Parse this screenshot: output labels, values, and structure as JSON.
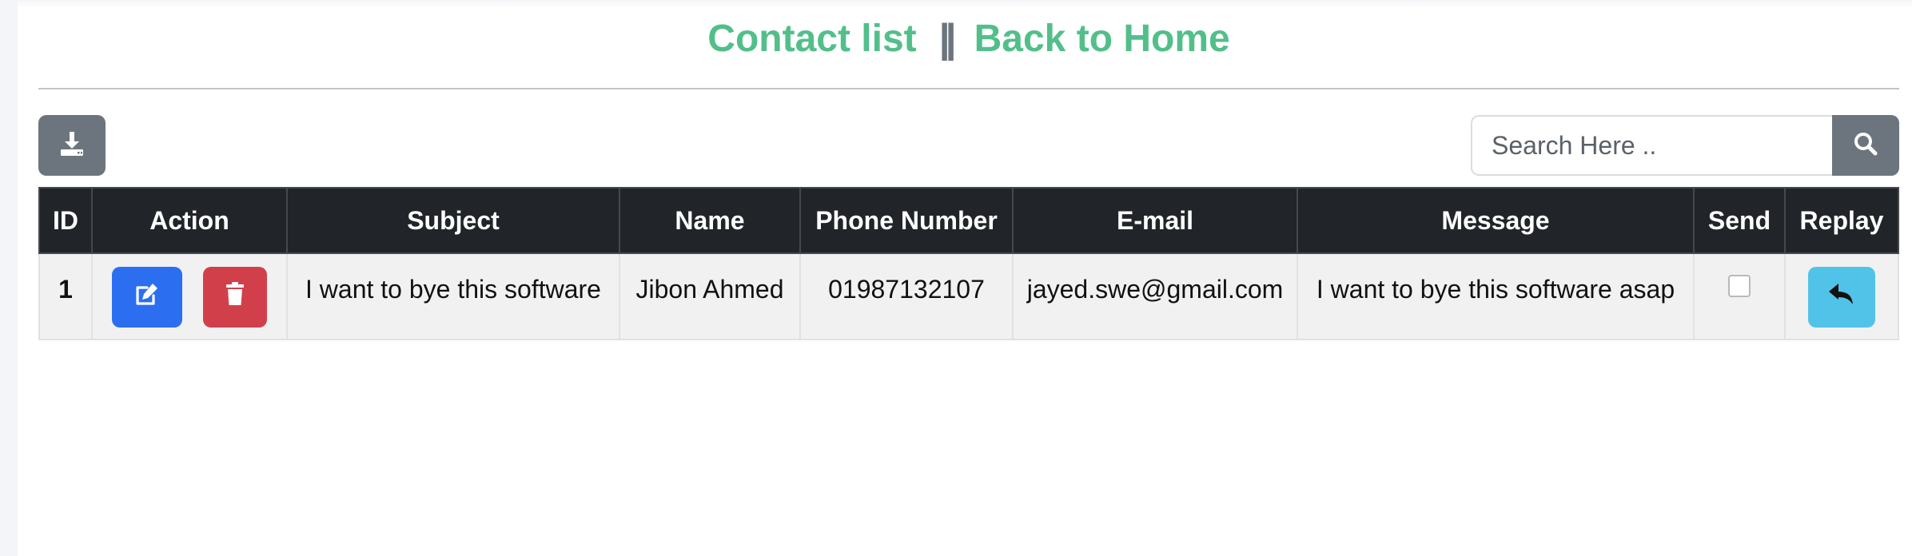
{
  "nav": {
    "contact_list": "Contact list",
    "separator": "||",
    "back_home": "Back to Home"
  },
  "toolbar": {
    "export_icon": "download-tray-icon",
    "search_placeholder": "Search Here ..",
    "search_icon": "magnifier-icon"
  },
  "table": {
    "headers": [
      "ID",
      "Action",
      "Subject",
      "Name",
      "Phone Number",
      "E-mail",
      "Message",
      "Send",
      "Replay"
    ],
    "rows": [
      {
        "id": "1",
        "subject": "I want to bye this software",
        "name": "Jibon Ahmed",
        "phone": "01987132107",
        "email": "jayed.swe@gmail.com",
        "message": "I want to bye this software asap",
        "send_checked": false
      }
    ]
  },
  "colors": {
    "nav_link": "#52bf8a",
    "header_bg": "#212529",
    "edit": "#2b6ff0",
    "delete": "#d1404a",
    "reply": "#52c3e8",
    "secondary": "#6c757d"
  }
}
